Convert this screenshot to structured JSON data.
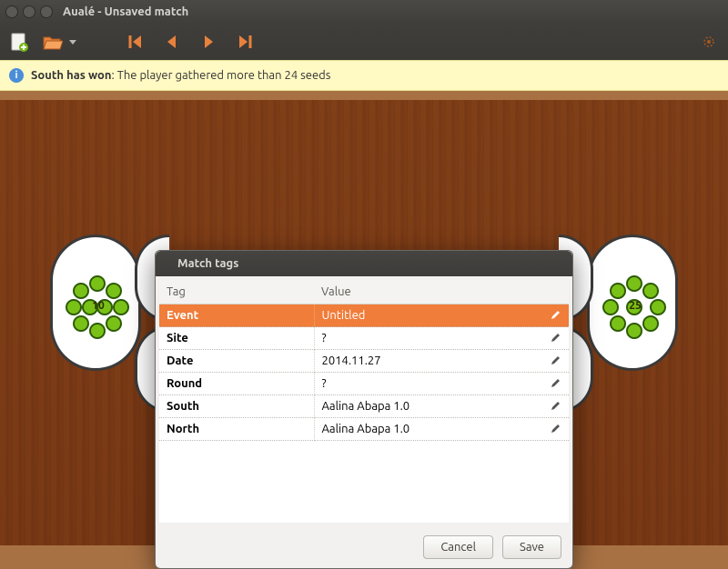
{
  "window": {
    "title": "Aualé - Unsaved match"
  },
  "toolbar": {
    "icons": [
      "new-file-icon",
      "open-file-icon",
      "goto-first-icon",
      "step-back-icon",
      "step-forward-icon",
      "goto-last-icon",
      "settings-icon"
    ]
  },
  "banner": {
    "strong": "South has won",
    "text": ": The player gathered more than 24 seeds"
  },
  "board": {
    "left_pit_count": "10",
    "right_pit_count": "25"
  },
  "dialog": {
    "title": "Match tags",
    "headers": {
      "tag": "Tag",
      "value": "Value"
    },
    "rows": [
      {
        "tag": "Event",
        "value": "Untitled",
        "selected": true
      },
      {
        "tag": "Site",
        "value": "?"
      },
      {
        "tag": "Date",
        "value": "2014.11.27"
      },
      {
        "tag": "Round",
        "value": "?"
      },
      {
        "tag": "South",
        "value": "Aalina Abapa 1.0"
      },
      {
        "tag": "North",
        "value": "Aalina Abapa 1.0"
      }
    ],
    "buttons": {
      "cancel": "Cancel",
      "save": "Save"
    }
  },
  "colors": {
    "accent": "#f07d3a",
    "arrow": "#e8813b"
  }
}
